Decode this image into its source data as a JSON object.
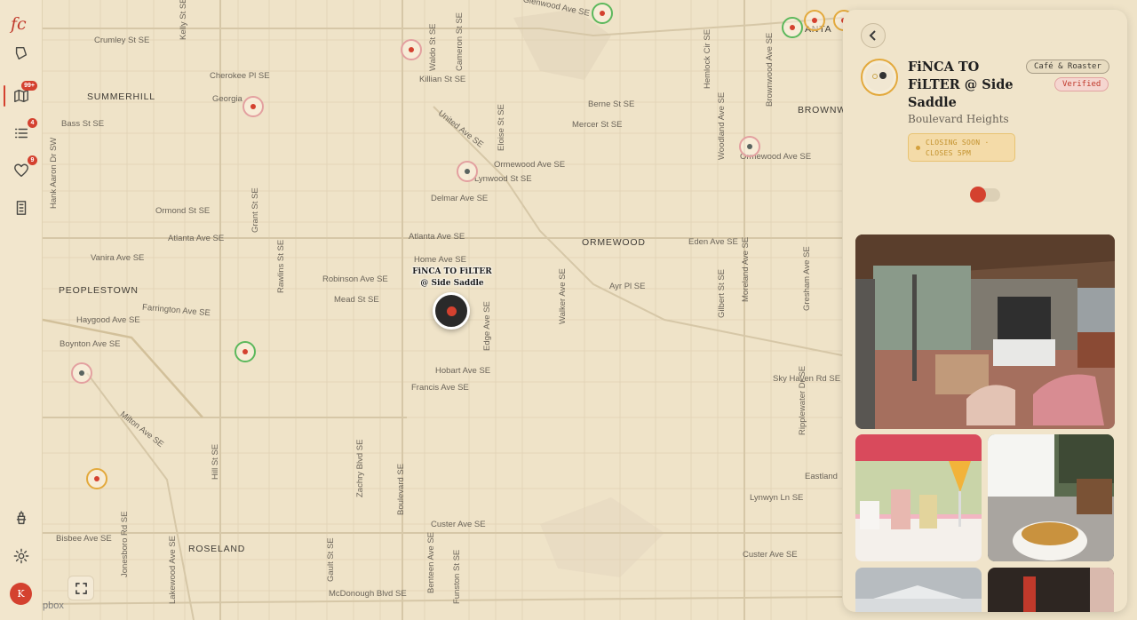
{
  "app": {
    "logo_text": "fc"
  },
  "sidebar": {
    "items": [
      {
        "name": "explore",
        "icon": "leaf-icon"
      },
      {
        "name": "map",
        "icon": "map-icon",
        "badge": "99+",
        "active": true
      },
      {
        "name": "list",
        "icon": "list-icon",
        "badge": "4"
      },
      {
        "name": "favorites",
        "icon": "heart-icon",
        "badge": "9"
      },
      {
        "name": "notes",
        "icon": "document-icon"
      }
    ],
    "bottom": [
      {
        "name": "coffee",
        "icon": "coffee-press-icon"
      },
      {
        "name": "settings",
        "icon": "gear-icon"
      }
    ],
    "avatar_initial": "K"
  },
  "map": {
    "attribution": "pbox",
    "neighborhoods": [
      "SUMMERHILL",
      "PEOPLESTOWN",
      "ORMEWOOD",
      "ROSELAND",
      "BROWNW",
      "ANTA"
    ],
    "streets": {
      "glenwood": "Glenwood Ave SE",
      "crumley": "Crumley St SE",
      "cherokee": "Cherokee Pl SE",
      "georgia": "Georgia",
      "bass": "Bass St SE",
      "killian": "Killian St SE",
      "berne": "Berne St SE",
      "mercer": "Mercer St SE",
      "ormewood": "Ormewood Ave SE",
      "ormewood2": "Ormewood Ave SE",
      "lynwood": "Lynwood St SE",
      "delmar": "Delmar Ave SE",
      "ormond": "Ormond St SE",
      "atlanta": "Atlanta Ave SE",
      "atlanta2": "Atlanta Ave SE",
      "eden": "Eden Ave SE",
      "vanira": "Vanira Ave SE",
      "home": "Home Ave SE",
      "robinson": "Robinson Ave SE",
      "mead": "Mead St SE",
      "ayr": "Ayr Pl SE",
      "farrington": "Farrington Ave SE",
      "haygood": "Haygood Ave SE",
      "boynton": "Boynton Ave SE",
      "hobart": "Hobart Ave SE",
      "francis": "Francis Ave SE",
      "skyhaven": "Sky Haven Rd SE",
      "milton": "Milton Ave SE",
      "eastland": "Eastland",
      "lynwyn": "Lynwyn Ln SE",
      "custer": "Custer Ave SE",
      "custer2": "Custer Ave SE",
      "bisbee": "Bisbee Ave SE",
      "mcdonough": "McDonough Blvd SE",
      "united": "United Ave SE",
      "waldo": "Waldo St SE",
      "cameron": "Cameron St SE",
      "eloise": "Eloise St SE",
      "grant": "Grant St SE",
      "hill": "Hill St SE",
      "boulevard": "Boulevard SE",
      "walker": "Walker Ave SE",
      "woodland": "Woodland Ave SE",
      "moreland": "Moreland Ave SE",
      "rawlins": "Rawlins St SE",
      "gilbert": "Gilbert St SE",
      "kelly": "Kelly St SE",
      "hemlock": "Hemlock Cir SE",
      "gresham": "Gresham Ave SE",
      "hank": "Hank Aaron Dr SW",
      "benteen": "Benteen Ave SE",
      "funston": "Funston St SE",
      "gault": "Gault St SE",
      "jonesboro": "Jonesboro Rd SE",
      "lakewood": "Lakewood Ave SE",
      "edgewood": "Edge Ave SE",
      "brownwood": "Brownwood Ave SE",
      "ripplewater": "Ripplewater Dr SE",
      "zachry": "Zachry Blvd SE"
    },
    "selected_label_line1": "FiNCA TO FiLTER",
    "selected_label_line2": "@ Side Saddle",
    "colors": {
      "accent": "#d4412f",
      "green": "#5cb85c",
      "gold": "#e3a93c",
      "map_bg": "#efe3c8"
    }
  },
  "panel": {
    "name": "FiNCA TO FiLTER @ Side Saddle",
    "neighborhood": "Boulevard Heights",
    "category": "Café & Roaster",
    "verified": "Verified",
    "hours_line1": "CLOSING SOON ·",
    "hours_line2": "CLOSES 5PM"
  }
}
